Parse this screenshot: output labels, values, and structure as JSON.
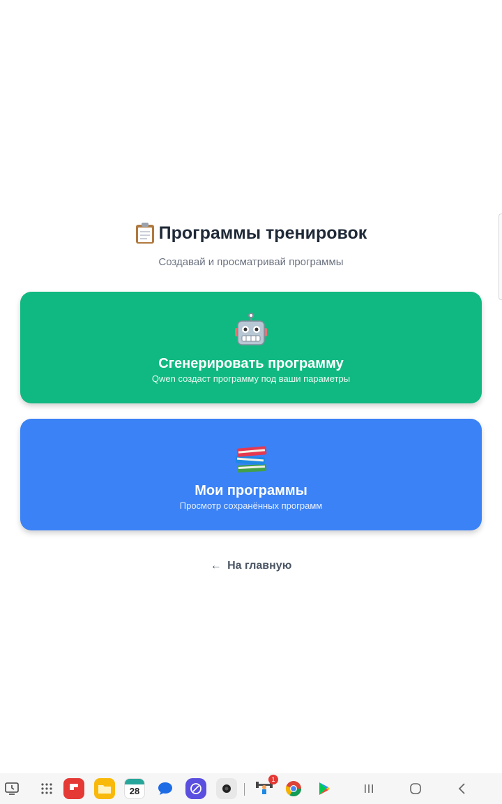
{
  "header": {
    "title": "Программы тренировок",
    "subtitle": "Создавай и просматривай программы",
    "title_icon": "clipboard-icon"
  },
  "cards": [
    {
      "icon": "robot-icon",
      "title": "Сгенерировать программу",
      "description": "Qwen создаст программу под ваши параметры",
      "color": "#10b981"
    },
    {
      "icon": "books-icon",
      "title": "Мои программы",
      "description": "Просмотр сохранённых программ",
      "color": "#3b82f6"
    }
  ],
  "back_link": {
    "arrow": "←",
    "label": "На главную"
  },
  "taskbar": {
    "calendar_day": "28",
    "fitness_badge": "1",
    "icons": [
      "screen-share-icon",
      "apps-grid-icon",
      "flipboard-icon",
      "files-icon",
      "calendar-icon",
      "messages-icon",
      "browser-icon",
      "camera-icon",
      "fitness-app-icon",
      "chrome-icon",
      "play-store-icon",
      "recents-icon",
      "home-icon",
      "back-icon"
    ]
  }
}
